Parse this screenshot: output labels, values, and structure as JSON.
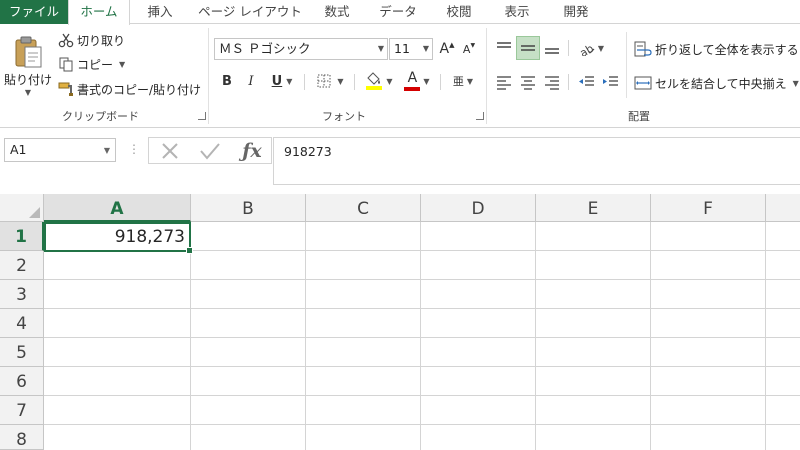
{
  "tabs": [
    "ファイル",
    "ホーム",
    "挿入",
    "ページ レイアウト",
    "数式",
    "データ",
    "校閲",
    "表示",
    "開発"
  ],
  "clipboard": {
    "paste_label": "貼り付け",
    "cut_label": "切り取り",
    "copy_label": "コピー",
    "format_painter_label": "書式のコピー/貼り付け",
    "group_label": "クリップボード"
  },
  "font": {
    "font_name": "ＭＳ Ｐゴシック",
    "font_size": "11",
    "grow_label": "A",
    "shrink_label": "A",
    "bold_label": "B",
    "italic_label": "I",
    "underline_label": "U",
    "font_color_label": "A",
    "phonetic_label": "亜",
    "group_label": "フォント"
  },
  "alignment": {
    "wrap_text_label": "折り返して全体を表示する",
    "merge_center_label": "セルを結合して中央揃え",
    "group_label": "配置"
  },
  "formula_bar": {
    "name_box": "A1",
    "dots": "⋮",
    "formula_value": "918273"
  },
  "sheet": {
    "columns": [
      "A",
      "B",
      "C",
      "D",
      "E",
      "F"
    ],
    "rows": [
      "1",
      "2",
      "3",
      "4",
      "5",
      "6",
      "7",
      "8"
    ],
    "selected_cell": "A1",
    "cell_a1_display": "918,273"
  },
  "colors": {
    "accent_green": "#217346",
    "font_color_bar": "#d40000",
    "fill_color_bar": "#ffff00"
  },
  "icons": [
    "clipboard-icon",
    "scissors-icon",
    "copy-icon",
    "brush-icon",
    "border-icon",
    "fill-icon",
    "cancel-icon",
    "check-icon",
    "fx-icon"
  ]
}
